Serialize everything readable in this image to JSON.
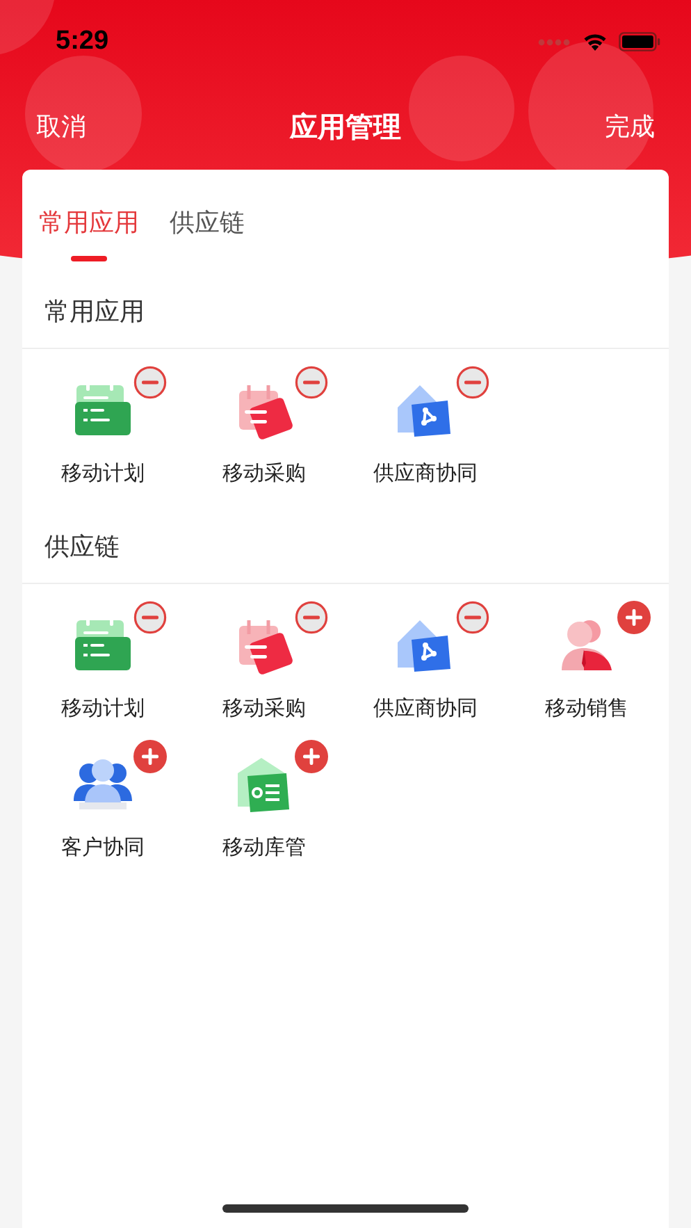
{
  "status_bar": {
    "time": "5:29"
  },
  "nav": {
    "cancel": "取消",
    "title": "应用管理",
    "done": "完成"
  },
  "tabs": [
    {
      "label": "常用应用",
      "selected": true
    },
    {
      "label": "供应链",
      "selected": false
    }
  ],
  "sections": [
    {
      "title": "常用应用",
      "apps": [
        {
          "label": "移动计划",
          "kind": "planner",
          "added": true
        },
        {
          "label": "移动采购",
          "kind": "bag",
          "added": true
        },
        {
          "label": "供应商协同",
          "kind": "house",
          "added": true
        }
      ]
    },
    {
      "title": "供应链",
      "apps": [
        {
          "label": "移动计划",
          "kind": "planner",
          "added": true
        },
        {
          "label": "移动采购",
          "kind": "bag",
          "added": true
        },
        {
          "label": "供应商协同",
          "kind": "house",
          "added": true
        },
        {
          "label": "移动销售",
          "kind": "person",
          "added": false
        },
        {
          "label": "客户协同",
          "kind": "people",
          "added": false
        },
        {
          "label": "移动库管",
          "kind": "warehouse",
          "added": false
        }
      ]
    }
  ]
}
